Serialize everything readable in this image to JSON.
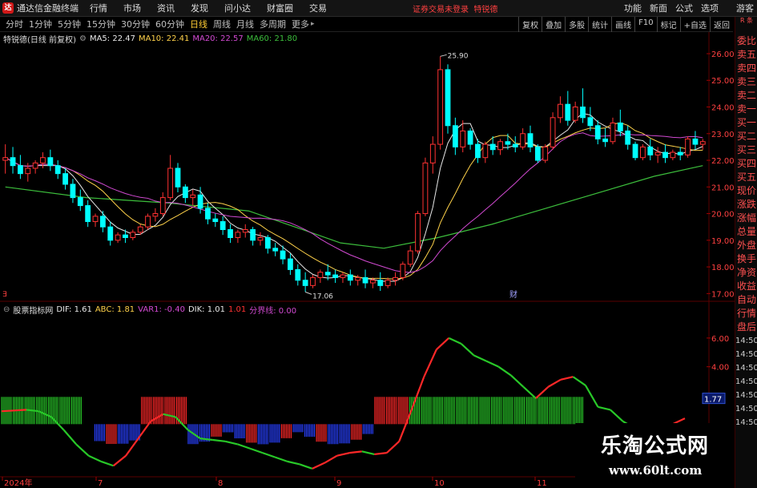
{
  "app": {
    "name": "通达信金融终端",
    "menu": [
      "行情",
      "市场",
      "资讯",
      "发现",
      "问小达",
      "财富圈",
      "交易"
    ],
    "notice": "证券交易未登录",
    "stock_name_top": "特锐德",
    "right_menu": [
      "功能",
      "新面",
      "公式",
      "选项",
      "游客"
    ]
  },
  "period_tabs": [
    {
      "label": "分时",
      "active": false
    },
    {
      "label": "1分钟",
      "active": false
    },
    {
      "label": "5分钟",
      "active": false
    },
    {
      "label": "15分钟",
      "active": false
    },
    {
      "label": "30分钟",
      "active": false
    },
    {
      "label": "60分钟",
      "active": false
    },
    {
      "label": "日线",
      "active": true
    },
    {
      "label": "周线",
      "active": false
    },
    {
      "label": "月线",
      "active": false
    },
    {
      "label": "多周期",
      "active": false
    },
    {
      "label": "更多",
      "active": false
    }
  ],
  "toolbar": [
    "复权",
    "叠加",
    "多股",
    "统计",
    "画线",
    "F10",
    "标记",
    "+自选",
    "返回"
  ],
  "kline_info": {
    "title": "特锐德(日线 前复权)",
    "ma5": "MA5: 22.47",
    "ma10": "MA10: 22.41",
    "ma20": "MA20: 22.57",
    "ma60": "MA60: 21.80"
  },
  "indicator_info": {
    "title": "股票指标网",
    "dif": "DIF: 1.61",
    "abc": "ABC: 1.81",
    "var1": "VAR1: -0.40",
    "dik": "DIK: 1.01",
    "v1": "1.01",
    "fjx": "分界线: 0.00"
  },
  "price_axis": [
    "26.00",
    "25.00",
    "24.00",
    "23.00",
    "22.00",
    "21.00",
    "20.00",
    "19.00",
    "18.00",
    "17.00"
  ],
  "indicator_axis": [
    "6.00",
    "4.00",
    "1.77"
  ],
  "time_axis": [
    "2024年",
    "7",
    "8",
    "9",
    "10",
    "11"
  ],
  "annotations": {
    "high": "25.90",
    "low": "17.06",
    "marker_left": "∃",
    "marker_fin": "财"
  },
  "right_panel": {
    "top": "R 条",
    "items": [
      "委比",
      "卖五",
      "卖四",
      "卖三",
      "卖二",
      "卖一",
      "买一",
      "买二",
      "买三",
      "买四",
      "买五",
      "现价",
      "涨跌",
      "涨幅",
      "总量",
      "外盘",
      "换手",
      "净资",
      "收益",
      "自动",
      "行情",
      "盘后",
      "14:50",
      "14:50",
      "14:50",
      "14:50",
      "14:50",
      "14:50",
      "14:50"
    ]
  },
  "watermark": {
    "line1": "乐淘公式网",
    "line2": "www.60lt.com"
  },
  "colors": {
    "up": "#ff3232",
    "down": "#00ffff",
    "ma5": "#e8e8e8",
    "ma10": "#ffd24a",
    "ma20": "#d24ad2",
    "ma60": "#3cbe3c"
  },
  "chart_data": {
    "type": "candlestick",
    "ylim": [
      16.8,
      26.3
    ],
    "candles": [
      [
        22.0,
        22.6,
        22.1,
        21.5
      ],
      [
        22.1,
        22.5,
        21.8,
        21.5
      ],
      [
        21.8,
        22.2,
        21.5,
        21.3
      ],
      [
        21.5,
        21.9,
        21.7,
        21.2
      ],
      [
        21.7,
        22.0,
        21.9,
        21.5
      ],
      [
        21.9,
        22.3,
        22.1,
        21.7
      ],
      [
        22.1,
        22.4,
        21.8,
        21.6
      ],
      [
        21.8,
        22.0,
        21.5,
        21.3
      ],
      [
        21.5,
        21.7,
        21.1,
        20.9
      ],
      [
        21.1,
        21.3,
        20.6,
        20.4
      ],
      [
        20.6,
        20.9,
        20.3,
        20.1
      ],
      [
        20.3,
        20.5,
        19.7,
        19.5
      ],
      [
        19.7,
        20.0,
        19.9,
        19.5
      ],
      [
        19.9,
        20.1,
        19.5,
        19.3
      ],
      [
        19.5,
        19.7,
        19.0,
        18.8
      ],
      [
        19.0,
        19.3,
        19.2,
        18.9
      ],
      [
        19.2,
        19.4,
        19.1,
        18.9
      ],
      [
        19.1,
        19.4,
        19.3,
        19.0
      ],
      [
        19.3,
        19.6,
        19.5,
        19.2
      ],
      [
        19.5,
        20.0,
        19.9,
        19.4
      ],
      [
        19.9,
        20.2,
        20.0,
        19.7
      ],
      [
        20.0,
        20.8,
        20.6,
        19.9
      ],
      [
        20.6,
        22.2,
        21.7,
        20.5
      ],
      [
        21.7,
        21.9,
        21.0,
        20.8
      ],
      [
        21.0,
        21.1,
        20.6,
        20.4
      ],
      [
        20.6,
        20.9,
        20.7,
        20.3
      ],
      [
        20.7,
        21.0,
        20.2,
        20.0
      ],
      [
        20.2,
        20.4,
        19.8,
        19.6
      ],
      [
        19.8,
        20.0,
        19.7,
        19.5
      ],
      [
        19.7,
        19.9,
        19.4,
        19.2
      ],
      [
        19.4,
        19.6,
        19.1,
        18.9
      ],
      [
        19.1,
        19.4,
        19.3,
        18.9
      ],
      [
        19.3,
        19.6,
        19.4,
        19.1
      ],
      [
        19.4,
        19.5,
        19.0,
        18.8
      ],
      [
        19.0,
        19.3,
        19.1,
        18.8
      ],
      [
        19.1,
        19.2,
        18.7,
        18.5
      ],
      [
        18.7,
        18.9,
        18.6,
        18.4
      ],
      [
        18.6,
        18.8,
        18.3,
        18.1
      ],
      [
        18.3,
        18.5,
        17.9,
        17.7
      ],
      [
        17.9,
        18.1,
        17.5,
        17.3
      ],
      [
        17.5,
        17.8,
        17.3,
        17.06
      ],
      [
        17.3,
        17.7,
        17.6,
        17.2
      ],
      [
        17.6,
        17.9,
        17.8,
        17.4
      ],
      [
        17.8,
        18.1,
        17.7,
        17.5
      ],
      [
        17.7,
        17.9,
        17.6,
        17.4
      ],
      [
        17.6,
        17.8,
        17.7,
        17.4
      ],
      [
        17.7,
        17.9,
        17.5,
        17.3
      ],
      [
        17.5,
        17.7,
        17.6,
        17.3
      ],
      [
        17.6,
        17.9,
        17.4,
        17.2
      ],
      [
        17.4,
        17.6,
        17.5,
        17.2
      ],
      [
        17.5,
        17.8,
        17.3,
        17.1
      ],
      [
        17.3,
        17.6,
        17.5,
        17.2
      ],
      [
        17.5,
        17.8,
        17.6,
        17.3
      ],
      [
        17.6,
        18.2,
        18.1,
        17.5
      ],
      [
        18.1,
        18.8,
        18.6,
        18.0
      ],
      [
        18.6,
        20.1,
        20.0,
        18.5
      ],
      [
        20.0,
        22.1,
        21.9,
        19.9
      ],
      [
        21.9,
        22.9,
        22.6,
        21.5
      ],
      [
        22.6,
        25.9,
        25.4,
        22.4
      ],
      [
        25.4,
        25.6,
        23.3,
        23.0
      ],
      [
        23.3,
        23.6,
        22.5,
        22.2
      ],
      [
        22.5,
        23.5,
        23.1,
        22.3
      ],
      [
        23.1,
        23.2,
        22.6,
        22.4
      ],
      [
        22.6,
        22.8,
        22.1,
        21.9
      ],
      [
        22.1,
        22.7,
        22.6,
        21.9
      ],
      [
        22.6,
        22.9,
        22.4,
        22.2
      ],
      [
        22.4,
        22.8,
        22.7,
        22.2
      ],
      [
        22.7,
        23.0,
        22.6,
        22.4
      ],
      [
        22.6,
        22.9,
        22.5,
        22.3
      ],
      [
        22.5,
        23.2,
        23.0,
        22.4
      ],
      [
        23.0,
        23.3,
        22.5,
        22.3
      ],
      [
        22.5,
        22.6,
        22.0,
        21.9
      ],
      [
        22.0,
        22.6,
        22.5,
        21.9
      ],
      [
        22.5,
        23.8,
        23.6,
        22.4
      ],
      [
        23.6,
        24.4,
        24.1,
        23.4
      ],
      [
        24.1,
        24.6,
        23.5,
        23.3
      ],
      [
        23.5,
        24.2,
        24.0,
        23.4
      ],
      [
        24.0,
        24.7,
        23.6,
        23.4
      ],
      [
        23.6,
        24.0,
        23.3,
        23.1
      ],
      [
        23.3,
        23.5,
        22.8,
        22.6
      ],
      [
        22.8,
        23.2,
        22.7,
        22.5
      ],
      [
        22.7,
        23.6,
        23.4,
        22.6
      ],
      [
        23.4,
        23.9,
        23.1,
        22.9
      ],
      [
        23.1,
        23.3,
        22.6,
        22.4
      ],
      [
        22.6,
        22.7,
        22.1,
        22.0
      ],
      [
        22.1,
        22.6,
        22.5,
        22.0
      ],
      [
        22.5,
        22.8,
        22.2,
        22.0
      ],
      [
        22.2,
        22.5,
        22.3,
        21.9
      ],
      [
        22.3,
        22.6,
        22.1,
        21.9
      ],
      [
        22.1,
        22.4,
        22.3,
        22.0
      ],
      [
        22.3,
        22.5,
        22.2,
        22.0
      ],
      [
        22.2,
        22.9,
        22.8,
        22.1
      ],
      [
        22.8,
        23.1,
        22.6,
        22.4
      ],
      [
        22.6,
        22.8,
        22.7,
        22.4
      ]
    ],
    "ma60": [
      [
        0,
        21.0
      ],
      [
        15,
        20.6
      ],
      [
        30,
        20.4
      ],
      [
        45,
        20.1
      ],
      [
        55,
        19.4
      ],
      [
        62,
        18.9
      ],
      [
        70,
        18.7
      ],
      [
        80,
        19.1
      ],
      [
        90,
        19.6
      ],
      [
        100,
        20.2
      ],
      [
        120,
        21.4
      ],
      [
        129,
        21.8
      ]
    ],
    "indicator": {
      "ylim": [
        -3.5,
        7.5
      ],
      "dif": [
        0.9,
        0.95,
        1.0,
        0.9,
        0.5,
        -0.4,
        -1.4,
        -2.2,
        -2.6,
        -2.9,
        -2.2,
        -1.0,
        0.2,
        0.7,
        0.5,
        -0.4,
        -1.0,
        -1.1,
        -1.2,
        -1.4,
        -1.7,
        -2.0,
        -2.3,
        -2.6,
        -2.8,
        -3.1,
        -2.7,
        -2.2,
        -2.0,
        -1.9,
        -2.1,
        -2.0,
        -1.2,
        1.0,
        3.3,
        5.2,
        6.0,
        5.6,
        4.8,
        4.4,
        4.0,
        3.4,
        2.6,
        1.8,
        2.6,
        3.1,
        3.3,
        2.7,
        1.2,
        1.0,
        0.2,
        -0.3,
        -0.5,
        -0.4,
        0.0,
        0.4
      ],
      "bars": [
        1,
        1,
        1,
        1,
        1,
        1,
        1,
        0,
        -1,
        -1,
        -1,
        -1,
        1,
        1,
        1,
        1,
        -1,
        -1,
        -1,
        -1,
        -1,
        -1,
        -1,
        -1,
        -1,
        -1,
        -1,
        -1,
        -1,
        -1,
        -1,
        -1,
        1,
        1,
        1,
        1,
        1,
        1,
        1,
        1,
        1,
        1,
        1,
        1,
        1,
        1,
        1,
        1,
        1,
        1
      ]
    }
  }
}
